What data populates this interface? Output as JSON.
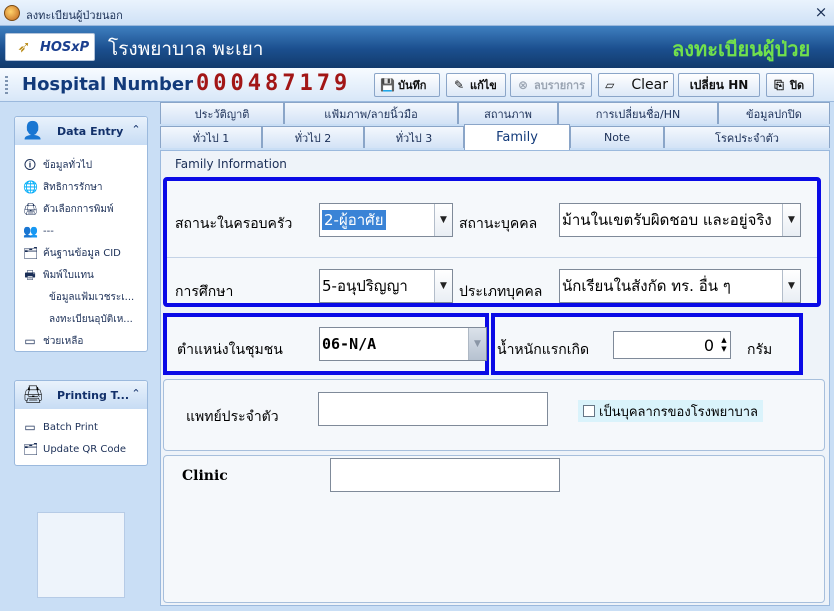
{
  "window": {
    "title": "ลงทะเบียนผู้ป่วยนอก",
    "close": "×"
  },
  "banner": {
    "logo_text": "HOSxP",
    "logo_icon": "runner-logo-icon",
    "hospital_name": "โรงพยาบาล พะเยา",
    "module_title": "ลงทะเบียนผู้ป่วย"
  },
  "toolbar": {
    "hn_label": "Hospital Number",
    "hn_value": "000487179",
    "buttons": {
      "save": "บันทึก",
      "edit": "แก้ไข",
      "delete": "ลบรายการ",
      "clear": "Clear",
      "change_hn": "เปลี่ยน HN",
      "close": "ปิด"
    }
  },
  "sidebar": {
    "data_entry": {
      "title": "Data Entry",
      "items": [
        {
          "label": "ข้อมูลทั่วไป",
          "icon": "person-info-icon"
        },
        {
          "label": "สิทธิการรักษา",
          "icon": "globe-icon"
        },
        {
          "label": "ตัวเลือกการพิมพ์",
          "icon": "print-options-icon"
        },
        {
          "label": "---",
          "icon": "users-icon"
        },
        {
          "label": "ค้นฐานข้อมูล CID",
          "icon": "card-search-icon"
        },
        {
          "label": "พิมพ์ใบแทน",
          "icon": "printer-icon"
        },
        {
          "label": "ข้อมูลแฟ้มเวชระเ..."
        },
        {
          "label": "ลงทะเบียนอุบัติเห..."
        },
        {
          "label": "ช่วยเหลือ",
          "icon": "help-icon"
        }
      ]
    },
    "printing": {
      "title": "Printing T...",
      "items": [
        {
          "label": "Batch Print",
          "icon": "batch-print-icon"
        },
        {
          "label": "Update QR Code",
          "icon": "qr-update-icon"
        }
      ]
    }
  },
  "tabs": {
    "row1": [
      "ประวัติญาติ",
      "แฟ้มภาพ/ลายนิ้วมือ",
      "สถานภาพ",
      "การเปลี่ยนชื่อ/HN",
      "ข้อมูลปกปิด"
    ],
    "row2": [
      "ทั่วไป 1",
      "ทั่วไป 2",
      "ทั่วไป 3",
      "Family",
      "Note",
      "โรคประจำตัว"
    ],
    "active": "Family"
  },
  "family": {
    "caption": "Family Information",
    "family_status": {
      "label": "สถานะในครอบครัว",
      "value": "2-ผู้อาศัย"
    },
    "person_status": {
      "label": "สถานะบุคคล",
      "value": "ม้านในเขตรับผิดชอบ และอยู่จริง"
    },
    "education": {
      "label": "การศึกษา",
      "value": "5-อนุปริญญา"
    },
    "person_type": {
      "label": "ประเภทบุคคล",
      "value": "นักเรียนในสังกัด ทร. อื่น ๆ"
    },
    "community_position": {
      "label": "ตำแหน่งในชุมชน",
      "value": "06-N/A"
    },
    "birth_weight": {
      "label": "น้ำหนักแรกเกิด",
      "value": "0",
      "unit": "กรัม"
    },
    "doctor": {
      "label": "แพทย์ประจำตัว",
      "value": ""
    },
    "hospital_staff": {
      "label": "เป็นบุคลากรของโรงพยาบาล"
    },
    "clinic": {
      "label": "Clinic",
      "value": ""
    }
  }
}
